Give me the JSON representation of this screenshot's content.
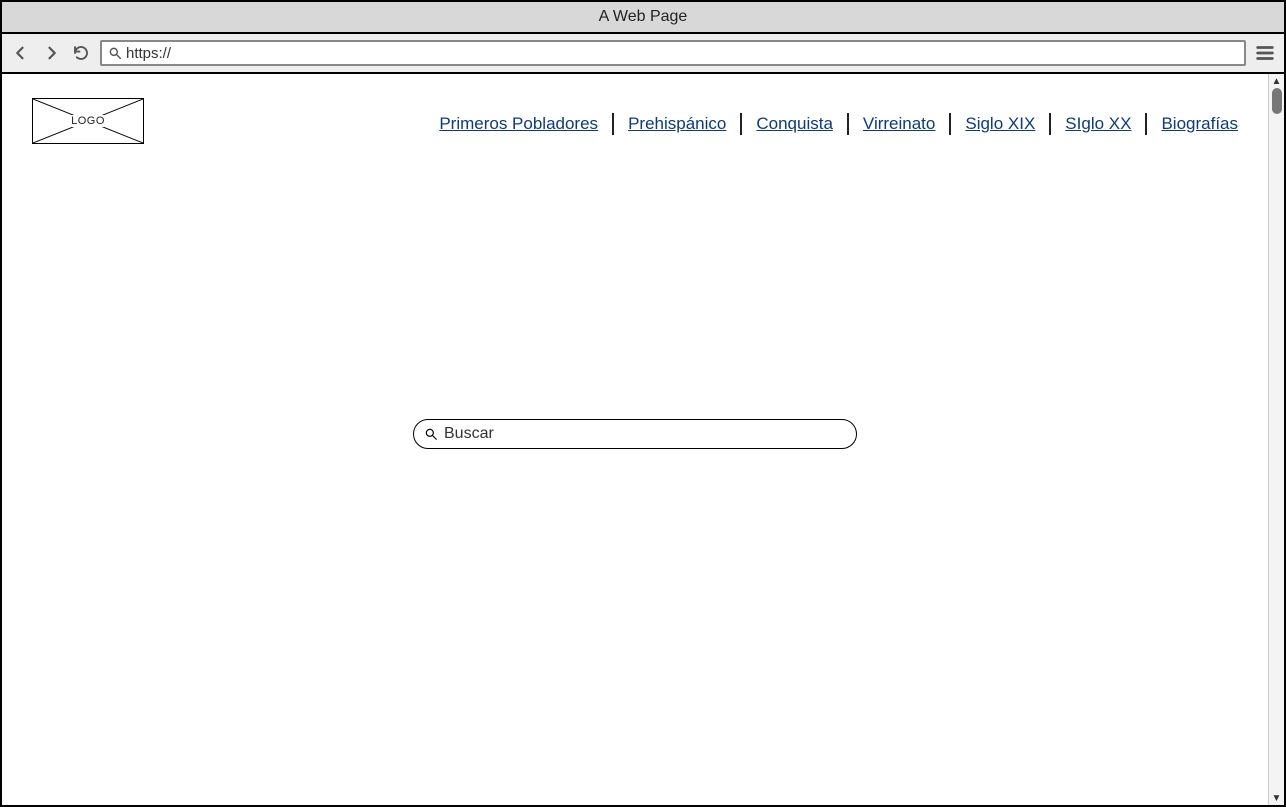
{
  "window": {
    "title": "A Web Page"
  },
  "address": {
    "value": "https://"
  },
  "logo": {
    "label": "LOGO"
  },
  "nav": {
    "items": [
      {
        "label": "Primeros Pobladores"
      },
      {
        "label": "Prehispánico"
      },
      {
        "label": "Conquista"
      },
      {
        "label": "Virreinato"
      },
      {
        "label": "Siglo XIX"
      },
      {
        "label": "SIglo XX"
      },
      {
        "label": "Biografías"
      }
    ]
  },
  "search": {
    "placeholder": "Buscar"
  }
}
